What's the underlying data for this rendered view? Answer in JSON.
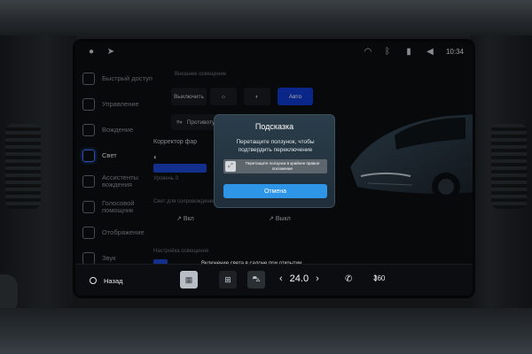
{
  "status_bar": {
    "time": "10:34",
    "icons": [
      "person-icon",
      "location-arrow-icon",
      "wifi-icon",
      "bluetooth-icon",
      "signal-icon",
      "volume-icon"
    ]
  },
  "sidebar": {
    "items": [
      {
        "label": "Быстрый доступ",
        "icon": "quick-access-icon",
        "active": false
      },
      {
        "label": "Управление",
        "icon": "steering-car-icon",
        "active": false
      },
      {
        "label": "Вождение",
        "icon": "steering-wheel-icon",
        "active": false
      },
      {
        "label": "Свет",
        "icon": "light-bulb-icon",
        "active": true
      },
      {
        "label": "Ассистенты вождения",
        "icon": "assist-icon",
        "active": false
      },
      {
        "label": "Голосовой помощник",
        "icon": "voice-icon",
        "active": false
      },
      {
        "label": "Отображение",
        "icon": "display-icon",
        "active": false
      },
      {
        "label": "Звук",
        "icon": "sound-icon",
        "active": false
      }
    ]
  },
  "content": {
    "exterior_label": "Внешнее освещение",
    "light_modes": [
      {
        "label": "Выключить",
        "selected": false
      },
      {
        "label": "",
        "icon": "parking-light-icon",
        "selected": false
      },
      {
        "label": "",
        "icon": "low-beam-icon",
        "selected": false
      },
      {
        "label": "Авто",
        "selected": true
      }
    ],
    "fog_label": "Противоту",
    "corrector_label": "Корректор фар",
    "level_label": "Уровень 0",
    "support_label": "Свет для сопровождения",
    "follow_me_on": "Вкл",
    "follow_me_off": "Выкл",
    "interior_label": "Настройка освещения",
    "interior_toggle_text": "Включение света в салоне при открытии"
  },
  "dialog": {
    "title": "Подсказка",
    "message": "Перетащите ползунок, чтобы подтвердить переключение",
    "slider_text": "Перетащите ползунок в крайнее правое положение",
    "cancel_label": "Отмена"
  },
  "bottom_bar": {
    "back_label": "Назад",
    "temperature": "24.0",
    "fan_label": "360"
  }
}
